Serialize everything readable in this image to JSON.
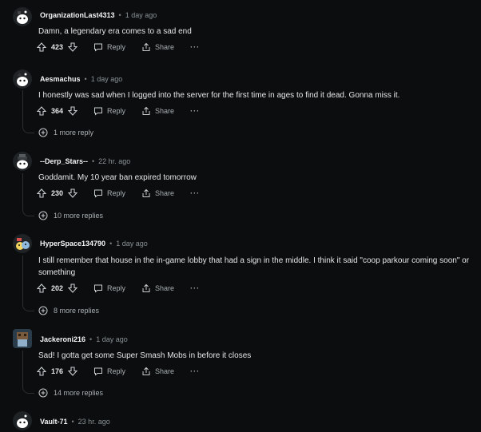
{
  "comments": [
    {
      "username": "OrganizationLast4313",
      "time": "1 day ago",
      "text": "Damn, a legendary era comes to a sad end",
      "votes": "423",
      "reply_label": "Reply",
      "share_label": "Share",
      "more_label": "···",
      "avatar_icon": "snoo-avatar-icon",
      "more_replies": ""
    },
    {
      "username": "Aesmachus",
      "time": "1 day ago",
      "text": "I honestly was sad when I logged into the server for the first time in ages to find it dead. Gonna miss it.",
      "votes": "364",
      "reply_label": "Reply",
      "share_label": "Share",
      "more_label": "···",
      "avatar_icon": "snoo-avatar-icon",
      "more_replies": "1 more reply"
    },
    {
      "username": "--Derp_Stars--",
      "time": "22 hr. ago",
      "text": "Goddamit. My 10 year ban expired tomorrow",
      "votes": "230",
      "reply_label": "Reply",
      "share_label": "Share",
      "more_label": "···",
      "avatar_icon": "snoo-hat-avatar-icon",
      "more_replies": "10 more replies"
    },
    {
      "username": "HyperSpace134790",
      "time": "1 day ago",
      "text": "I still remember that house in the in-game lobby that had a sign in the middle. I think it said \"coop parkour coming soon\" or something",
      "votes": "202",
      "reply_label": "Reply",
      "share_label": "Share",
      "more_label": "···",
      "avatar_icon": "snoo-costume-avatar-icon",
      "more_replies": "8 more replies"
    },
    {
      "username": "Jackeroni216",
      "time": "1 day ago",
      "text": "Sad! I gotta get some Super Smash Mobs in before it closes",
      "votes": "176",
      "reply_label": "Reply",
      "share_label": "Share",
      "more_label": "···",
      "avatar_icon": "block-avatar-icon",
      "more_replies": "14 more replies"
    },
    {
      "username": "Vault-71",
      "time": "23 hr. ago",
      "avatar_icon": "snoo-avatar-icon"
    }
  ],
  "colors": {
    "background": "#0b0d0e",
    "thread_line": "#2a2f31",
    "text_muted": "#a9b0b3"
  }
}
